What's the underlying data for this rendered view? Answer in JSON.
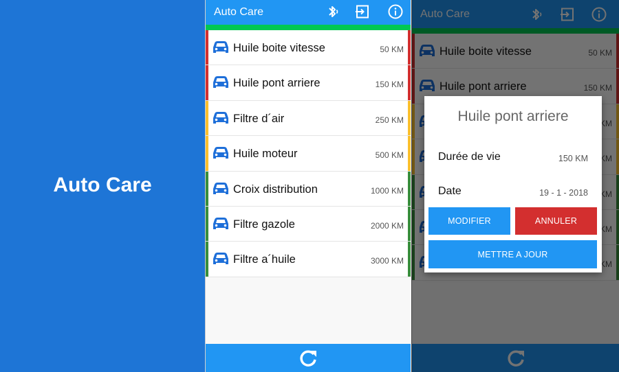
{
  "splash": {
    "title": "Auto Care"
  },
  "app": {
    "title": "Auto Care",
    "icons": [
      "bluetooth-icon",
      "logout-icon",
      "info-icon",
      "refresh-icon"
    ],
    "items": [
      {
        "name": "Huile boite vitesse",
        "km": "50 KM",
        "status": "red"
      },
      {
        "name": "Huile pont arriere",
        "km": "150 KM",
        "status": "red"
      },
      {
        "name": "Filtre d´air",
        "km": "250 KM",
        "status": "yellow"
      },
      {
        "name": "Huile moteur",
        "km": "500 KM",
        "status": "yellow"
      },
      {
        "name": "Croix distribution",
        "km": "1000 KM",
        "status": "green"
      },
      {
        "name": "Filtre gazole",
        "km": "2000 KM",
        "status": "green"
      },
      {
        "name": "Filtre a´huile",
        "km": "3000 KM",
        "status": "green"
      }
    ]
  },
  "dialog": {
    "title": "Huile pont arriere",
    "lifespan_label": "Durée de vie",
    "lifespan_value": "150 KM",
    "date_label": "Date",
    "date_value": "19 - 1 - 2018",
    "modify_label": "MODIFIER",
    "cancel_label": "ANNULER",
    "update_label": "METTRE A JOUR"
  },
  "colors": {
    "primary": "#2196f3",
    "splash": "#1e75d6",
    "red": "#d32f2f",
    "yellow": "#fbc02d",
    "green": "#388e3c",
    "strip": "#00c853",
    "car": "#1e6fd9"
  }
}
